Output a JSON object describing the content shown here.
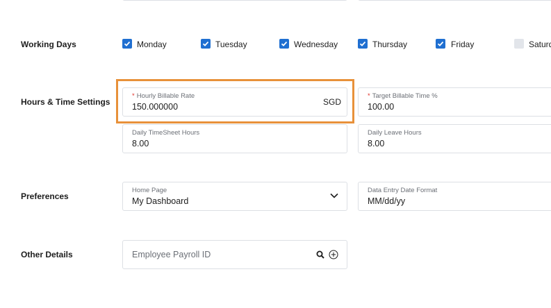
{
  "sections": {
    "working_days": "Working Days",
    "hours_time": "Hours & Time Settings",
    "preferences": "Preferences",
    "other_details": "Other Details"
  },
  "days": [
    {
      "label": "Monday",
      "checked": true
    },
    {
      "label": "Tuesday",
      "checked": true
    },
    {
      "label": "Wednesday",
      "checked": true
    },
    {
      "label": "Thursday",
      "checked": true
    },
    {
      "label": "Friday",
      "checked": true
    },
    {
      "label": "Saturd",
      "checked": false
    }
  ],
  "hours": {
    "hourly_rate_label": "Hourly Billable Rate",
    "hourly_rate_value": "150.000000",
    "currency": "SGD",
    "target_label": "Target Billable Time %",
    "target_value": "100.00",
    "timesheet_label": "Daily TimeSheet Hours",
    "timesheet_value": "8.00",
    "leave_label": "Daily Leave Hours",
    "leave_value": "8.00",
    "required_mark": "*"
  },
  "preferences": {
    "home_page_label": "Home Page",
    "home_page_value": "My Dashboard",
    "date_format_label": "Data Entry Date Format",
    "date_format_value": "MM/dd/yy"
  },
  "other": {
    "payroll_placeholder": "Employee Payroll ID"
  },
  "colors": {
    "accent": "#1f6fd1",
    "highlight": "#e8913a",
    "required": "#e0322a"
  },
  "icons": [
    "check-icon",
    "chevron-down-icon",
    "search-icon",
    "plus-circle-icon"
  ]
}
